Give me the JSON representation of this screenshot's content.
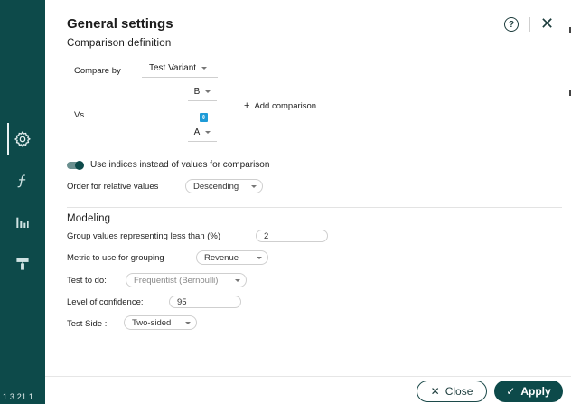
{
  "sidebar": {
    "version": "1.3.21.1",
    "items": [
      {
        "icon": "gear-icon",
        "active": true
      },
      {
        "icon": "function-icon",
        "active": false
      },
      {
        "icon": "bar-chart-icon",
        "active": false
      },
      {
        "icon": "paint-roller-icon",
        "active": false
      }
    ]
  },
  "header": {
    "title": "General settings",
    "help_symbol": "?",
    "close_symbol": "✕"
  },
  "comparison": {
    "section_title": "Comparison definition",
    "compare_by_label": "Compare by",
    "compare_by_value": "Test Variant",
    "first_value": "B",
    "vs_label": "Vs.",
    "second_value": "A",
    "add_comparison_label": "Add comparison",
    "use_indices_label": "Use indices instead of values for comparison",
    "use_indices_enabled": true,
    "order_label": "Order for relative values",
    "order_value": "Descending"
  },
  "modeling": {
    "section_title": "Modeling",
    "group_label": "Group values representing less than (%)",
    "group_value": "2",
    "metric_label": "Metric to use for grouping",
    "metric_value": "Revenue",
    "test_label": "Test to do:",
    "test_value": "Frequentist (Bernoulli)",
    "confidence_label": "Level of confidence:",
    "confidence_value": "95",
    "side_label": "Test Side :",
    "side_value": "Two-sided"
  },
  "footer": {
    "close_label": "Close",
    "apply_label": "Apply"
  },
  "colors": {
    "sidebar": "#0d4a4a",
    "accent": "#1e9bd7"
  }
}
